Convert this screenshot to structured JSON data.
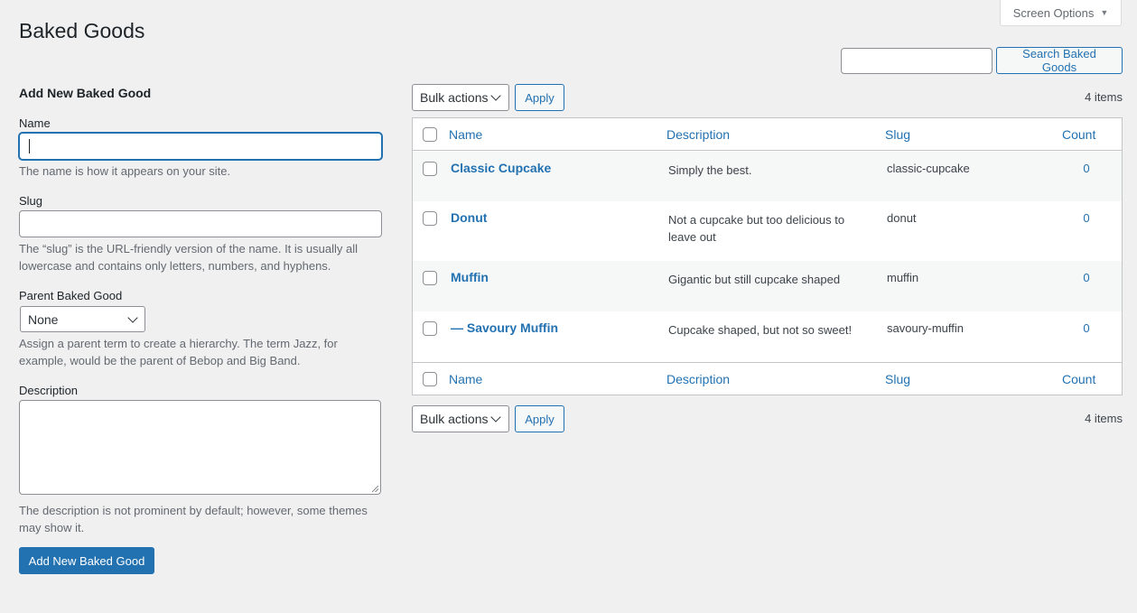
{
  "screen_options": {
    "label": "Screen Options",
    "caret": "▼"
  },
  "page": {
    "title": "Baked Goods"
  },
  "search": {
    "value": "",
    "button_label": "Search Baked Goods"
  },
  "form": {
    "title": "Add New Baked Good",
    "name": {
      "label": "Name",
      "value": "",
      "help": "The name is how it appears on your site."
    },
    "slug": {
      "label": "Slug",
      "value": "",
      "help": "The “slug” is the URL-friendly version of the name. It is usually all lowercase and contains only letters, numbers, and hyphens."
    },
    "parent": {
      "label": "Parent Baked Good",
      "selected": "None",
      "help": "Assign a parent term to create a hierarchy. The term Jazz, for example, would be the parent of Bebop and Big Band."
    },
    "description": {
      "label": "Description",
      "value": "",
      "help": "The description is not prominent by default; however, some themes may show it."
    },
    "submit_label": "Add New Baked Good"
  },
  "bulk": {
    "select_label": "Bulk actions",
    "apply_label": "Apply",
    "items_count": "4 items"
  },
  "table": {
    "columns": {
      "name": "Name",
      "description": "Description",
      "slug": "Slug",
      "count": "Count"
    },
    "rows": [
      {
        "name": "Classic Cupcake",
        "description": "Simply the best.",
        "slug": "classic-cupcake",
        "count": "0"
      },
      {
        "name": "Donut",
        "description": "Not a cupcake but too delicious to leave out",
        "slug": "donut",
        "count": "0"
      },
      {
        "name": "Muffin",
        "description": "Gigantic but still cupcake shaped",
        "slug": "muffin",
        "count": "0"
      },
      {
        "name": "— Savoury Muffin",
        "description": "Cupcake shaped, but not so sweet!",
        "slug": "savoury-muffin",
        "count": "0"
      }
    ]
  },
  "colors": {
    "accent": "#2271b1",
    "background": "#f0f0f1",
    "text": "#3c434a",
    "muted": "#646970"
  },
  "icons": {
    "screen_options_caret": "caret-down-icon",
    "select_chevron": "chevron-down-icon"
  }
}
